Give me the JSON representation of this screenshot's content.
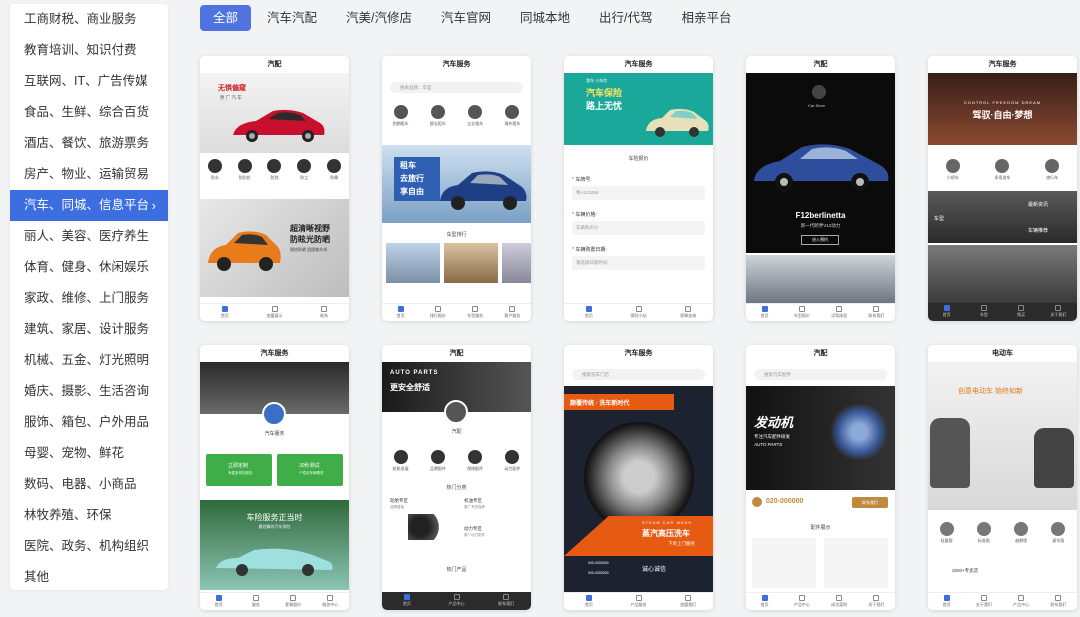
{
  "sidebar": {
    "items": [
      {
        "label": "工商财税、商业服务"
      },
      {
        "label": "教育培训、知识付费"
      },
      {
        "label": "互联网、IT、广告传媒"
      },
      {
        "label": "食品、生鲜、综合百货"
      },
      {
        "label": "酒店、餐饮、旅游票务"
      },
      {
        "label": "房产、物业、运输贸易"
      },
      {
        "label": "汽车、同城、信息平台"
      },
      {
        "label": "丽人、美容、医疗养生"
      },
      {
        "label": "体育、健身、休闲娱乐"
      },
      {
        "label": "家政、维修、上门服务"
      },
      {
        "label": "建筑、家居、设计服务"
      },
      {
        "label": "机械、五金、灯光照明"
      },
      {
        "label": "婚庆、摄影、生活咨询"
      },
      {
        "label": "服饰、箱包、户外用品"
      },
      {
        "label": "母婴、宠物、鲜花"
      },
      {
        "label": "数码、电器、小商品"
      },
      {
        "label": "林牧养殖、环保"
      },
      {
        "label": "医院、政务、机构组织"
      },
      {
        "label": "其他"
      }
    ],
    "active_index": 6,
    "chevron": "›"
  },
  "tabs": [
    {
      "label": "全部"
    },
    {
      "label": "汽车汽配"
    },
    {
      "label": "汽美/汽修店"
    },
    {
      "label": "汽车官网"
    },
    {
      "label": "同城本地"
    },
    {
      "label": "出行/代驾"
    },
    {
      "label": "相亲平台"
    }
  ],
  "cards": {
    "c1": {
      "title": "汽配",
      "banner1": "无惧偏窥",
      "banner1_sub": "原 厂 汽 车",
      "icons": [
        "防水",
        "防刮花",
        "防划",
        "防尘",
        "防霉"
      ],
      "banner2": "超清晰视野",
      "banner2b": "防眩光防晒",
      "banner2_sub": "隔热防晒 阻隔紫外线",
      "nav": [
        "首页",
        "加盟展示",
        "联系"
      ]
    },
    "c2": {
      "title": "汽车服务",
      "search": "搜索品牌、车型",
      "icons": [
        "到期租车",
        "超长租车",
        "企业租车",
        "境外租车"
      ],
      "banner": [
        "租车",
        "去旅行",
        "享自由"
      ],
      "section": "车型排行",
      "nav": [
        "首页",
        "排行报价",
        "车型服务",
        "客户服务"
      ]
    },
    "c3": {
      "title": "汽车服务",
      "banner_small": "我车 小车险",
      "banner": [
        "汽车保险",
        "路上无忧"
      ],
      "section": "车险报价",
      "f1": "车牌号:",
      "f1v": "粤A123456",
      "f2": "车辆价格:",
      "f2v": "车辆购买价",
      "f3": "车辆购置日期:",
      "f3v": "请选择日期时间",
      "nav": [
        "首页",
        "保险小站",
        "保障咨询"
      ]
    },
    "c4": {
      "title": "汽配",
      "brand": "Car Store",
      "model": "F12berlinetta",
      "model_sub": "新一代跨界V12动力",
      "btn": "进入预约",
      "nav": [
        "首页",
        "车型报价",
        "试驾体验",
        "联系我们"
      ]
    },
    "c5": {
      "title": "汽车服务",
      "banner_en": "CONTROL  FREEDOM  DREAM",
      "banner": "驾驭·自由·梦想",
      "icons": [
        "小轿车",
        "多用途车",
        "旅行车"
      ],
      "label1": "最新资讯",
      "label2": "车型",
      "label3": "车辆推荐",
      "nav": [
        "首页",
        "车型",
        "购买",
        "关于我们"
      ]
    },
    "c6": {
      "title": "汽车服务",
      "sub": "汽车服务",
      "btn1": "立即定制",
      "btn1s": "专属多样化服务",
      "btn2": "30秒测试",
      "btn2s": "个性化车辆需求",
      "banner": "车险服务正当时",
      "banner_sub": "最划算的汽车保险",
      "nav": [
        "首页",
        "服务",
        "套餐报价",
        "服务中心"
      ]
    },
    "c7": {
      "title": "汽配",
      "banner_en": "AUTO PARTS",
      "banner": "更安全舒适",
      "sub": "汽配",
      "icons": [
        "轮胎发展",
        "品牌配件",
        "保修配件",
        "动力配件"
      ],
      "section": "热门分类",
      "cat1": "轮胎专区",
      "cat1s": "品牌直营",
      "cat2": "机油专区",
      "cat2s": "原厂专供保养",
      "cat3": "动力专区",
      "cat3s": "原厂动力配件",
      "section2": "热门产品",
      "nav": [
        "首页",
        "产品中心",
        "联系我们"
      ]
    },
    "c8": {
      "title": "汽车服务",
      "search": "搜索洗车门店",
      "ribbon": "颠覆传统 · 洗车新时代",
      "en": "STEAM CAR WASH",
      "big": "蒸汽高压洗车",
      "sub": "下单上门服务",
      "phone1": "000-0000000",
      "phone2": "000-0000000",
      "logo": "诚心诚信",
      "nav": [
        "首页",
        "产品服务",
        "加盟我们"
      ]
    },
    "c9": {
      "title": "汽配",
      "search": "搜索汽车配件",
      "banner": "发动机",
      "banner_sub": "专注汽车配件研发",
      "banner_en": "AUTO PARTS",
      "phone": "020-000000",
      "btn": "联系我们",
      "section": "配件展示",
      "nav": [
        "首页",
        "产品中心",
        "成功案例",
        "关于我们"
      ]
    },
    "c10": {
      "title": "电动车",
      "banner": "创意电动车 始终如新",
      "icons": [
        "轻量版",
        "标准版",
        "越野版",
        "豪华版"
      ],
      "promo": "2500+专卖店",
      "nav": [
        "首页",
        "关于我们",
        "产品中心",
        "联系我们"
      ]
    }
  }
}
